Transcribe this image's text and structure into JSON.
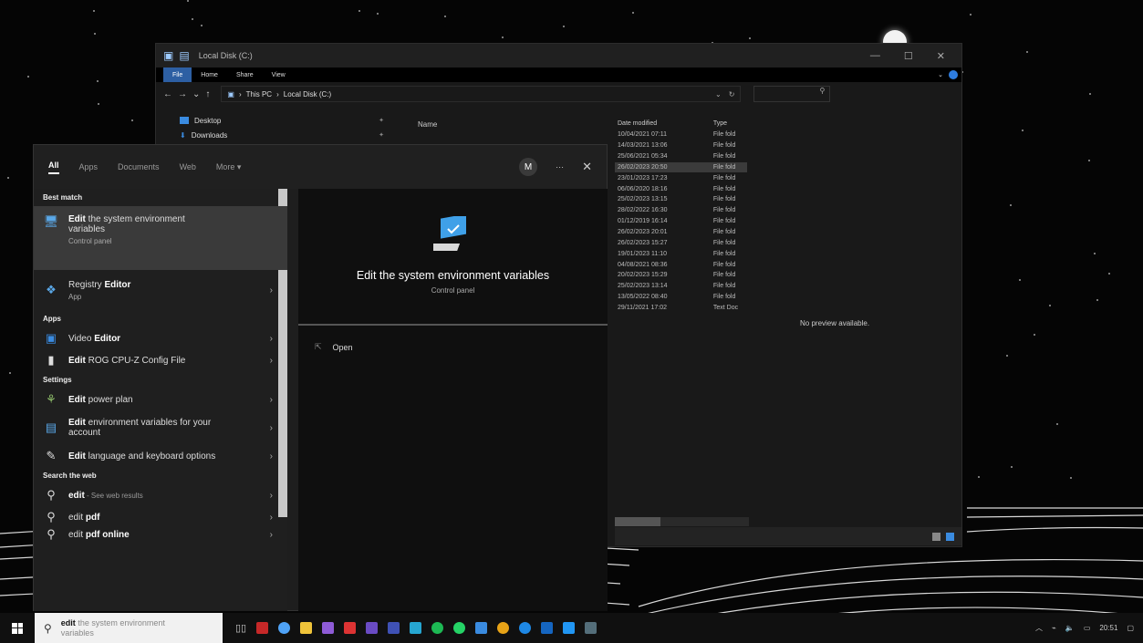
{
  "explorer": {
    "title": "Local Disk (C:)",
    "ribbon_tabs": [
      "File",
      "Home",
      "Share",
      "View"
    ],
    "breadcrumb": [
      "This PC",
      "Local Disk (C:)"
    ],
    "nav_items": [
      "Desktop",
      "Downloads"
    ],
    "columns": {
      "name": "Name",
      "date": "Date modified",
      "type": "Type"
    },
    "rows": [
      {
        "date": "10/04/2021 07:11",
        "type": "File fold"
      },
      {
        "date": "14/03/2021 13:06",
        "type": "File fold"
      },
      {
        "date": "25/06/2021 05:34",
        "type": "File fold"
      },
      {
        "date": "26/02/2023 20:50",
        "type": "File fold"
      },
      {
        "date": "23/01/2023 17:23",
        "type": "File fold"
      },
      {
        "date": "06/06/2020 18:16",
        "type": "File fold"
      },
      {
        "date": "25/02/2023 13:15",
        "type": "File fold"
      },
      {
        "date": "28/02/2022 16:30",
        "type": "File fold"
      },
      {
        "date": "01/12/2019 16:14",
        "type": "File fold"
      },
      {
        "date": "26/02/2023 20:01",
        "type": "File fold"
      },
      {
        "date": "26/02/2023 15:27",
        "type": "File fold"
      },
      {
        "date": "19/01/2023 11:10",
        "type": "File fold"
      },
      {
        "date": "04/08/2021 08:36",
        "type": "File fold"
      },
      {
        "date": "20/02/2023 15:29",
        "type": "File fold"
      },
      {
        "date": "25/02/2023 13:14",
        "type": "File fold"
      },
      {
        "date": "13/05/2022 08:40",
        "type": "File fold"
      },
      {
        "date": "29/11/2021 17:02",
        "type": "Text Doc"
      }
    ],
    "preview_message": "No preview available."
  },
  "search_panel": {
    "tabs": [
      "All",
      "Apps",
      "Documents",
      "Web",
      "More"
    ],
    "avatar_initial": "M",
    "best_match": {
      "header": "Best match",
      "title_bold": "Edit",
      "title_rest": " the system environment variables",
      "subtitle": "Control panel"
    },
    "registry": {
      "title": "Registry ",
      "title_bold": "Editor",
      "subtitle": "App"
    },
    "apps_header": "Apps",
    "apps": [
      {
        "pre": "Video ",
        "bold": "Editor",
        "post": ""
      },
      {
        "pre": "",
        "bold": "Edit",
        "post": " ROG CPU-Z Config File"
      }
    ],
    "settings_header": "Settings",
    "settings": [
      {
        "bold": "Edit",
        "post": " power plan"
      },
      {
        "bold": "Edit",
        "post": " environment variables for your account"
      },
      {
        "bold": "Edit",
        "post": " language and keyboard options"
      }
    ],
    "web_header": "Search the web",
    "web": [
      {
        "bold": "edit",
        "hint": " - See web results"
      },
      {
        "pre": "edit ",
        "bold": "pdf",
        "hint": ""
      },
      {
        "pre": "edit ",
        "bold": "pdf online",
        "hint": ""
      }
    ],
    "detail": {
      "title": "Edit the system environment variables",
      "subtitle": "Control panel",
      "action": "Open"
    }
  },
  "taskbar": {
    "search_typed": "edit",
    "search_ghost": " the system environment variables",
    "time": "20:51"
  },
  "colors": {
    "accent": "#2d5fa3",
    "selection": "#3a3a3a"
  }
}
